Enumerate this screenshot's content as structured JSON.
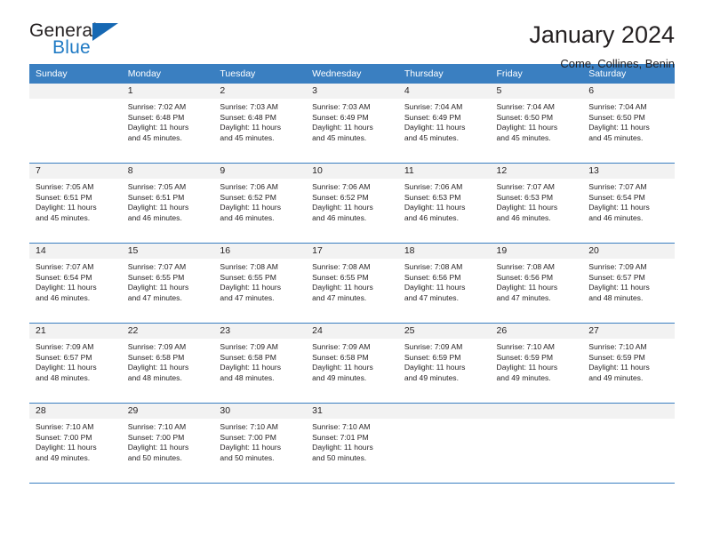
{
  "brand": {
    "word_one": "General",
    "word_two": "Blue",
    "triangle_icon": "triangle-icon"
  },
  "header": {
    "title": "January 2024",
    "subtitle": "Come, Collines, Benin"
  },
  "colors": {
    "header_blue": "#3a7fc1",
    "brand_blue": "#1f7ac4",
    "daynum_bg": "#f2f2f2",
    "text": "#231f20"
  },
  "weekdays": [
    "Sunday",
    "Monday",
    "Tuesday",
    "Wednesday",
    "Thursday",
    "Friday",
    "Saturday"
  ],
  "labels": {
    "sunrise_prefix": "Sunrise: ",
    "sunset_prefix": "Sunset: ",
    "daylight_prefix": "Daylight: "
  },
  "weeks": [
    [
      {
        "day": "",
        "blank": true
      },
      {
        "day": "1",
        "sunrise": "Sunrise: 7:02 AM",
        "sunset": "Sunset: 6:48 PM",
        "daylight_1": "Daylight: 11 hours",
        "daylight_2": "and 45 minutes."
      },
      {
        "day": "2",
        "sunrise": "Sunrise: 7:03 AM",
        "sunset": "Sunset: 6:48 PM",
        "daylight_1": "Daylight: 11 hours",
        "daylight_2": "and 45 minutes."
      },
      {
        "day": "3",
        "sunrise": "Sunrise: 7:03 AM",
        "sunset": "Sunset: 6:49 PM",
        "daylight_1": "Daylight: 11 hours",
        "daylight_2": "and 45 minutes."
      },
      {
        "day": "4",
        "sunrise": "Sunrise: 7:04 AM",
        "sunset": "Sunset: 6:49 PM",
        "daylight_1": "Daylight: 11 hours",
        "daylight_2": "and 45 minutes."
      },
      {
        "day": "5",
        "sunrise": "Sunrise: 7:04 AM",
        "sunset": "Sunset: 6:50 PM",
        "daylight_1": "Daylight: 11 hours",
        "daylight_2": "and 45 minutes."
      },
      {
        "day": "6",
        "sunrise": "Sunrise: 7:04 AM",
        "sunset": "Sunset: 6:50 PM",
        "daylight_1": "Daylight: 11 hours",
        "daylight_2": "and 45 minutes."
      }
    ],
    [
      {
        "day": "7",
        "sunrise": "Sunrise: 7:05 AM",
        "sunset": "Sunset: 6:51 PM",
        "daylight_1": "Daylight: 11 hours",
        "daylight_2": "and 45 minutes."
      },
      {
        "day": "8",
        "sunrise": "Sunrise: 7:05 AM",
        "sunset": "Sunset: 6:51 PM",
        "daylight_1": "Daylight: 11 hours",
        "daylight_2": "and 46 minutes."
      },
      {
        "day": "9",
        "sunrise": "Sunrise: 7:06 AM",
        "sunset": "Sunset: 6:52 PM",
        "daylight_1": "Daylight: 11 hours",
        "daylight_2": "and 46 minutes."
      },
      {
        "day": "10",
        "sunrise": "Sunrise: 7:06 AM",
        "sunset": "Sunset: 6:52 PM",
        "daylight_1": "Daylight: 11 hours",
        "daylight_2": "and 46 minutes."
      },
      {
        "day": "11",
        "sunrise": "Sunrise: 7:06 AM",
        "sunset": "Sunset: 6:53 PM",
        "daylight_1": "Daylight: 11 hours",
        "daylight_2": "and 46 minutes."
      },
      {
        "day": "12",
        "sunrise": "Sunrise: 7:07 AM",
        "sunset": "Sunset: 6:53 PM",
        "daylight_1": "Daylight: 11 hours",
        "daylight_2": "and 46 minutes."
      },
      {
        "day": "13",
        "sunrise": "Sunrise: 7:07 AM",
        "sunset": "Sunset: 6:54 PM",
        "daylight_1": "Daylight: 11 hours",
        "daylight_2": "and 46 minutes."
      }
    ],
    [
      {
        "day": "14",
        "sunrise": "Sunrise: 7:07 AM",
        "sunset": "Sunset: 6:54 PM",
        "daylight_1": "Daylight: 11 hours",
        "daylight_2": "and 46 minutes."
      },
      {
        "day": "15",
        "sunrise": "Sunrise: 7:07 AM",
        "sunset": "Sunset: 6:55 PM",
        "daylight_1": "Daylight: 11 hours",
        "daylight_2": "and 47 minutes."
      },
      {
        "day": "16",
        "sunrise": "Sunrise: 7:08 AM",
        "sunset": "Sunset: 6:55 PM",
        "daylight_1": "Daylight: 11 hours",
        "daylight_2": "and 47 minutes."
      },
      {
        "day": "17",
        "sunrise": "Sunrise: 7:08 AM",
        "sunset": "Sunset: 6:55 PM",
        "daylight_1": "Daylight: 11 hours",
        "daylight_2": "and 47 minutes."
      },
      {
        "day": "18",
        "sunrise": "Sunrise: 7:08 AM",
        "sunset": "Sunset: 6:56 PM",
        "daylight_1": "Daylight: 11 hours",
        "daylight_2": "and 47 minutes."
      },
      {
        "day": "19",
        "sunrise": "Sunrise: 7:08 AM",
        "sunset": "Sunset: 6:56 PM",
        "daylight_1": "Daylight: 11 hours",
        "daylight_2": "and 47 minutes."
      },
      {
        "day": "20",
        "sunrise": "Sunrise: 7:09 AM",
        "sunset": "Sunset: 6:57 PM",
        "daylight_1": "Daylight: 11 hours",
        "daylight_2": "and 48 minutes."
      }
    ],
    [
      {
        "day": "21",
        "sunrise": "Sunrise: 7:09 AM",
        "sunset": "Sunset: 6:57 PM",
        "daylight_1": "Daylight: 11 hours",
        "daylight_2": "and 48 minutes."
      },
      {
        "day": "22",
        "sunrise": "Sunrise: 7:09 AM",
        "sunset": "Sunset: 6:58 PM",
        "daylight_1": "Daylight: 11 hours",
        "daylight_2": "and 48 minutes."
      },
      {
        "day": "23",
        "sunrise": "Sunrise: 7:09 AM",
        "sunset": "Sunset: 6:58 PM",
        "daylight_1": "Daylight: 11 hours",
        "daylight_2": "and 48 minutes."
      },
      {
        "day": "24",
        "sunrise": "Sunrise: 7:09 AM",
        "sunset": "Sunset: 6:58 PM",
        "daylight_1": "Daylight: 11 hours",
        "daylight_2": "and 49 minutes."
      },
      {
        "day": "25",
        "sunrise": "Sunrise: 7:09 AM",
        "sunset": "Sunset: 6:59 PM",
        "daylight_1": "Daylight: 11 hours",
        "daylight_2": "and 49 minutes."
      },
      {
        "day": "26",
        "sunrise": "Sunrise: 7:10 AM",
        "sunset": "Sunset: 6:59 PM",
        "daylight_1": "Daylight: 11 hours",
        "daylight_2": "and 49 minutes."
      },
      {
        "day": "27",
        "sunrise": "Sunrise: 7:10 AM",
        "sunset": "Sunset: 6:59 PM",
        "daylight_1": "Daylight: 11 hours",
        "daylight_2": "and 49 minutes."
      }
    ],
    [
      {
        "day": "28",
        "sunrise": "Sunrise: 7:10 AM",
        "sunset": "Sunset: 7:00 PM",
        "daylight_1": "Daylight: 11 hours",
        "daylight_2": "and 49 minutes."
      },
      {
        "day": "29",
        "sunrise": "Sunrise: 7:10 AM",
        "sunset": "Sunset: 7:00 PM",
        "daylight_1": "Daylight: 11 hours",
        "daylight_2": "and 50 minutes."
      },
      {
        "day": "30",
        "sunrise": "Sunrise: 7:10 AM",
        "sunset": "Sunset: 7:00 PM",
        "daylight_1": "Daylight: 11 hours",
        "daylight_2": "and 50 minutes."
      },
      {
        "day": "31",
        "sunrise": "Sunrise: 7:10 AM",
        "sunset": "Sunset: 7:01 PM",
        "daylight_1": "Daylight: 11 hours",
        "daylight_2": "and 50 minutes."
      },
      {
        "day": "",
        "empty": true
      },
      {
        "day": "",
        "empty": true
      },
      {
        "day": "",
        "empty": true
      }
    ]
  ]
}
